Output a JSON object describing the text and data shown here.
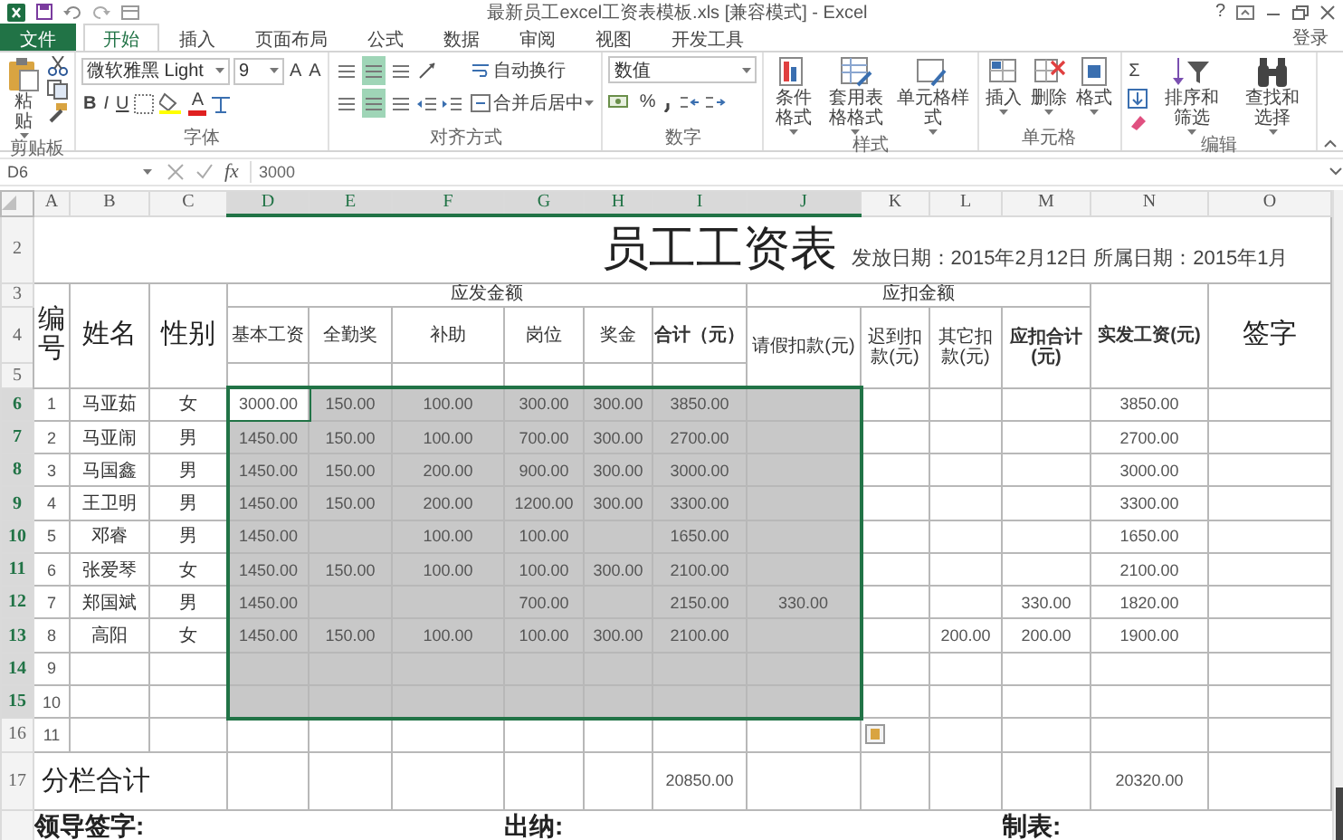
{
  "window": {
    "title": "最新员工excel工资表模板.xls [兼容模式] - Excel",
    "help": "?",
    "sign_in": "登录"
  },
  "ribbon": {
    "tabs": [
      {
        "label": "文件",
        "kind": "file"
      },
      {
        "label": "开始",
        "kind": "tab",
        "selected": true
      },
      {
        "label": "插入",
        "kind": "tab",
        "selected": false
      },
      {
        "label": "页面布局",
        "kind": "tab",
        "selected": false
      },
      {
        "label": "公式",
        "kind": "tab",
        "selected": false
      },
      {
        "label": "数据",
        "kind": "tab",
        "selected": false
      },
      {
        "label": "审阅",
        "kind": "tab",
        "selected": false
      },
      {
        "label": "视图",
        "kind": "tab",
        "selected": false
      },
      {
        "label": "开发工具",
        "kind": "tab",
        "selected": false
      }
    ],
    "clipboard": {
      "label": "剪贴板",
      "paste": "粘贴"
    },
    "font": {
      "label": "字体",
      "font_name": "微软雅黑 Light",
      "font_size": "9",
      "grow": "A",
      "shrink": "A",
      "styles": [
        "B",
        "I",
        "U"
      ],
      "font_color": "A"
    },
    "alignment": {
      "label": "对齐方式",
      "toggles": [
        {
          "selected": false
        },
        {
          "selected": true
        },
        {
          "selected": false
        },
        {
          "selected": false
        },
        {
          "selected": true
        },
        {
          "selected": false
        }
      ],
      "wrap_text": "自动换行",
      "merge_center": "合并后居中"
    },
    "number": {
      "label": "数字",
      "format": "数值",
      "percent": "%"
    },
    "styles": {
      "label": "样式",
      "buttons": [
        "条件格式",
        "套用表格格式",
        "单元格样式"
      ]
    },
    "cells": {
      "label": "单元格",
      "buttons": [
        "插入",
        "删除",
        "格式"
      ]
    },
    "editing": {
      "label": "编辑",
      "sum": "Σ",
      "buttons": [
        "排序和筛选",
        "查找和选择"
      ]
    }
  },
  "formula_bar": {
    "name_box": "D6",
    "function_label": "fx",
    "formula": "3000"
  },
  "sheet": {
    "columns": [
      {
        "label": "A",
        "selected": false
      },
      {
        "label": "B",
        "selected": false
      },
      {
        "label": "C",
        "selected": false
      },
      {
        "label": "D",
        "selected": true
      },
      {
        "label": "E",
        "selected": true
      },
      {
        "label": "F",
        "selected": true
      },
      {
        "label": "G",
        "selected": true
      },
      {
        "label": "H",
        "selected": true
      },
      {
        "label": "I",
        "selected": true
      },
      {
        "label": "J",
        "selected": true
      },
      {
        "label": "K",
        "selected": false
      },
      {
        "label": "L",
        "selected": false
      },
      {
        "label": "M",
        "selected": false
      },
      {
        "label": "N",
        "selected": false
      },
      {
        "label": "O",
        "selected": false
      }
    ],
    "title_row": {
      "number": "2",
      "title": "员工工资表",
      "dates": "发放日期：2015年2月12日 所属日期：2015年1月"
    },
    "header": {
      "row_numbers": [
        "3",
        "4",
        "5"
      ],
      "left": [
        "编号",
        "姓名",
        "性别"
      ],
      "groups": [
        "应发金额",
        "应扣金额"
      ],
      "earnings": [
        "基本工资",
        "全勤奖",
        "补助",
        "岗位",
        "奖金",
        "合计（元）"
      ],
      "deductions": [
        "请假扣款(元)",
        "迟到扣款(元)",
        "其它扣款(元)",
        "应扣合计(元)"
      ],
      "right": [
        "实发工资(元)",
        "签字"
      ]
    },
    "rows": [
      {
        "number": "6",
        "selected": true,
        "cells": [
          "1",
          "马亚茹",
          "女",
          "3000.00",
          "150.00",
          "100.00",
          "300.00",
          "300.00",
          "3850.00",
          null,
          null,
          null,
          null,
          "3850.00",
          null
        ]
      },
      {
        "number": "7",
        "selected": true,
        "cells": [
          "2",
          "马亚闹",
          "男",
          "1450.00",
          "150.00",
          "100.00",
          "700.00",
          "300.00",
          "2700.00",
          null,
          null,
          null,
          null,
          "2700.00",
          null
        ]
      },
      {
        "number": "8",
        "selected": true,
        "cells": [
          "3",
          "马国鑫",
          "男",
          "1450.00",
          "150.00",
          "200.00",
          "900.00",
          "300.00",
          "3000.00",
          null,
          null,
          null,
          null,
          "3000.00",
          null
        ]
      },
      {
        "number": "9",
        "selected": true,
        "cells": [
          "4",
          "王卫明",
          "男",
          "1450.00",
          "150.00",
          "200.00",
          "1200.00",
          "300.00",
          "3300.00",
          null,
          null,
          null,
          null,
          "3300.00",
          null
        ]
      },
      {
        "number": "10",
        "selected": true,
        "cells": [
          "5",
          "邓睿",
          "男",
          "1450.00",
          null,
          "100.00",
          "100.00",
          null,
          "1650.00",
          null,
          null,
          null,
          null,
          "1650.00",
          null
        ]
      },
      {
        "number": "11",
        "selected": true,
        "cells": [
          "6",
          "张爱琴",
          "女",
          "1450.00",
          "150.00",
          "100.00",
          "100.00",
          "300.00",
          "2100.00",
          null,
          null,
          null,
          null,
          "2100.00",
          null
        ]
      },
      {
        "number": "12",
        "selected": true,
        "cells": [
          "7",
          "郑国斌",
          "男",
          "1450.00",
          null,
          null,
          "700.00",
          null,
          "2150.00",
          "330.00",
          null,
          null,
          "330.00",
          "1820.00",
          null
        ]
      },
      {
        "number": "13",
        "selected": true,
        "cells": [
          "8",
          "高阳",
          "女",
          "1450.00",
          "150.00",
          "100.00",
          "100.00",
          "300.00",
          "2100.00",
          null,
          null,
          "200.00",
          "200.00",
          "1900.00",
          null
        ]
      },
      {
        "number": "14",
        "selected": true,
        "cells": [
          "9",
          null,
          null,
          null,
          null,
          null,
          null,
          null,
          null,
          null,
          null,
          null,
          null,
          null,
          null
        ]
      },
      {
        "number": "15",
        "selected": true,
        "cells": [
          "10",
          null,
          null,
          null,
          null,
          null,
          null,
          null,
          null,
          null,
          null,
          null,
          null,
          null,
          null
        ]
      },
      {
        "number": "16",
        "selected": false,
        "cells": [
          "11",
          null,
          null,
          null,
          null,
          null,
          null,
          null,
          null,
          null,
          null,
          null,
          null,
          null,
          null
        ]
      }
    ],
    "total_row": {
      "number": "17",
      "label": "分栏合计",
      "cells": [
        null,
        null,
        null,
        null,
        null,
        "20850.00",
        null,
        null,
        null,
        null,
        "20320.00",
        null
      ]
    },
    "signatures": [
      "领导签字:",
      "出纳:",
      "制表:"
    ]
  }
}
